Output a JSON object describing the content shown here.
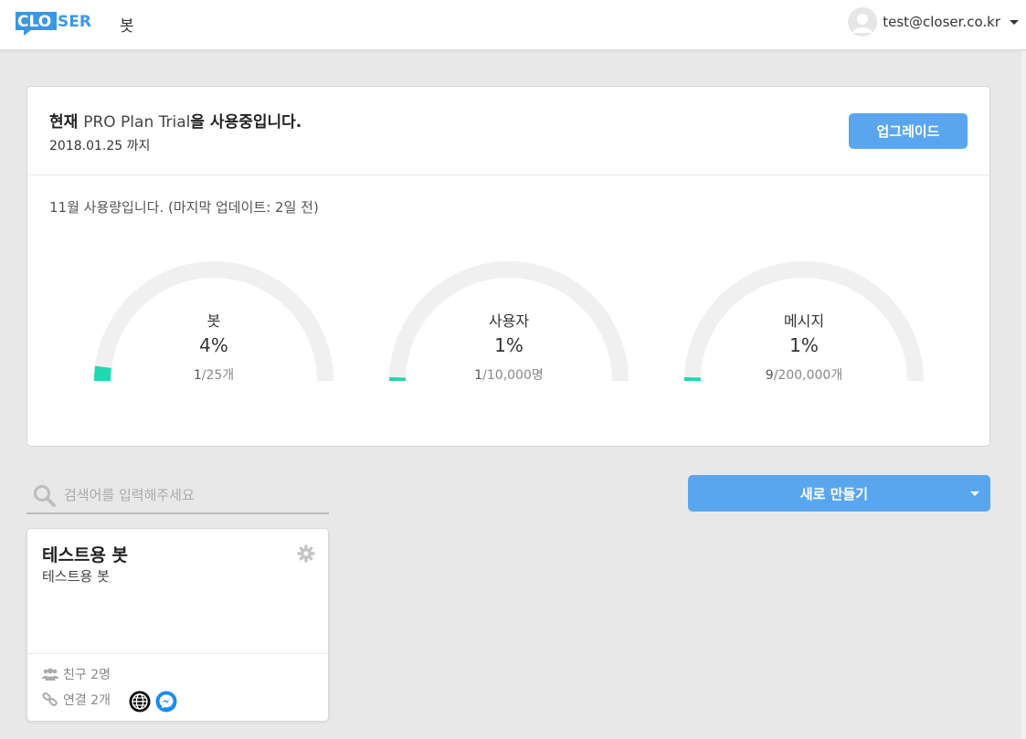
{
  "header": {
    "logo_text": "CLOSER",
    "nav_title": "봇",
    "user_email": "test@closer.co.kr"
  },
  "plan": {
    "title_prefix": "현재 ",
    "plan_name": "PRO Plan Trial",
    "title_suffix": "을 사용중입니다.",
    "expiry": "2018.01.25 까지",
    "upgrade_label": "업그레이드",
    "usage_caption": "11월 사용량입니다. (마지막 업데이트: 2일 전)",
    "gauges": [
      {
        "label": "봇",
        "percent": "4%",
        "current": "1",
        "limit": "/25개",
        "fraction": 0.04
      },
      {
        "label": "사용자",
        "percent": "1%",
        "current": "1",
        "limit": "/10,000명",
        "fraction": 0.01
      },
      {
        "label": "메시지",
        "percent": "1%",
        "current": "9",
        "limit": "/200,000개",
        "fraction": 0.01
      }
    ]
  },
  "search": {
    "placeholder": "검색어를 입력해주세요",
    "value": ""
  },
  "new_button": {
    "label": "새로 만들기"
  },
  "bot_card": {
    "name": "테스트용 봇",
    "description": "테스트용 봇",
    "friends": "친구 2명",
    "connections": "연결 2개",
    "channels": [
      "globe-icon",
      "messenger-icon"
    ]
  },
  "colors": {
    "accent": "#5aa6ee",
    "gauge_fill": "#1ed8b0",
    "gauge_track": "#f0f0f0",
    "logo_blue": "#3b97e3"
  }
}
